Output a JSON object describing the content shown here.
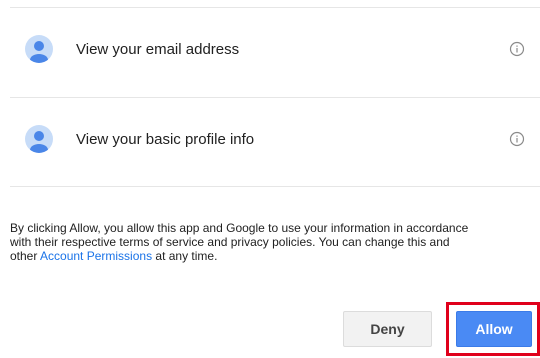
{
  "permissions": [
    {
      "label": "View your email address",
      "icon": "person-avatar-icon",
      "info_icon": "info-icon"
    },
    {
      "label": "View your basic profile info",
      "icon": "person-avatar-icon",
      "info_icon": "info-icon"
    }
  ],
  "consent": {
    "line1": "By clicking Allow, you allow this app and Google to use your information in accordance",
    "line2": "with their respective terms of service and privacy policies. You can change this and",
    "line3_prefix": "other ",
    "link_text": "Account Permissions",
    "line3_suffix": " at any time."
  },
  "buttons": {
    "deny_label": "Deny",
    "allow_label": "Allow"
  },
  "colors": {
    "allow_button": "#4a8af4",
    "link": "#1a73e8",
    "highlight_border": "#e0001b",
    "avatar_bg": "#c7dcf8",
    "avatar_fg": "#4a86e8"
  }
}
